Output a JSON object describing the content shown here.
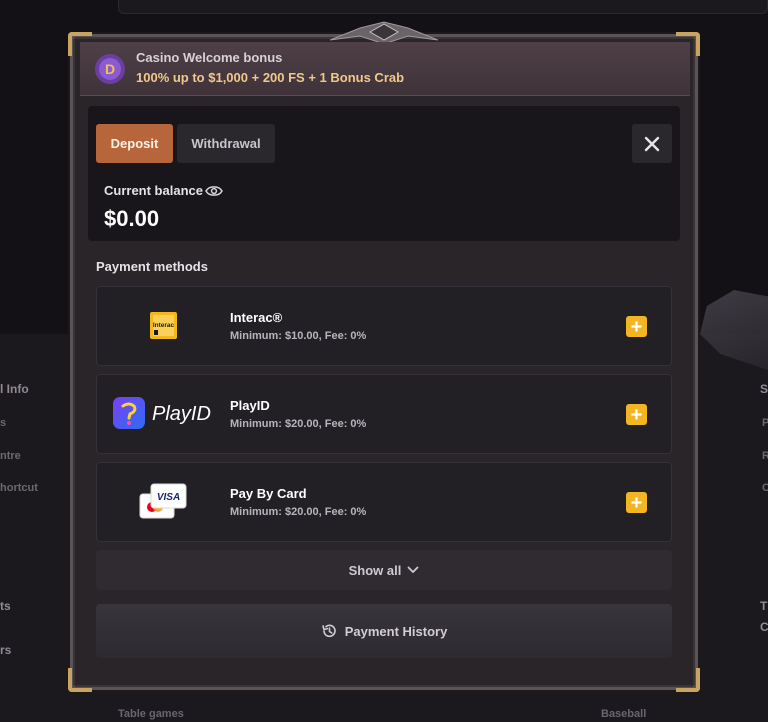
{
  "background": {
    "left_items": [
      "l Info",
      "s",
      "ntre",
      "hortcut",
      "ts",
      "rs"
    ],
    "right_items": [
      "S",
      "P",
      "R",
      "C",
      "T",
      "C"
    ],
    "bottom_links": [
      "Table games",
      "Baseball"
    ]
  },
  "banner": {
    "title": "Casino Welcome bonus",
    "subtitle": "100% up to $1,000 + 200 FS + 1 Bonus Crab",
    "icon": "bonus-coin-icon"
  },
  "wallet": {
    "tabs": [
      {
        "label": "Deposit",
        "active": true
      },
      {
        "label": "Withdrawal",
        "active": false
      }
    ],
    "balance_label": "Current balance",
    "balance_value": "$0.00"
  },
  "payment_methods": {
    "title": "Payment methods",
    "items": [
      {
        "name": "Interac®",
        "limits": "Minimum: $10.00, Fee: 0%",
        "logo": "interac-logo",
        "logo_text": "Interac"
      },
      {
        "name": "PlayID",
        "limits": "Minimum: $20.00, Fee: 0%",
        "logo": "playid-logo",
        "logo_text": "PlayID"
      },
      {
        "name": "Pay By Card",
        "limits": "Minimum: $20.00, Fee: 0%",
        "logo": "card-logo",
        "logo_text": "VISA"
      }
    ],
    "show_all": "Show all",
    "history": "Payment History"
  },
  "colors": {
    "accent_deposit": "#b7663b",
    "add_button": "#f2b624",
    "banner_subtitle": "#f0c98a"
  }
}
